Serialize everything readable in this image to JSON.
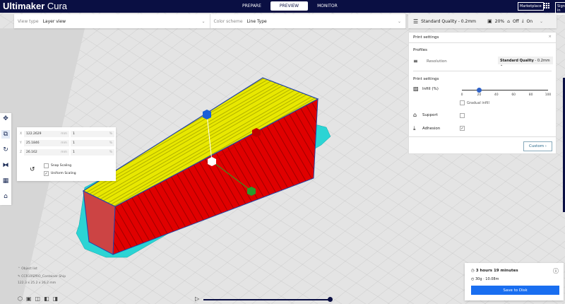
{
  "app": {
    "title_bold": "Ultimaker",
    "title_light": " Cura"
  },
  "nav": {
    "tabs": [
      {
        "label": "PREPARE",
        "active": false
      },
      {
        "label": "PREVIEW",
        "active": true
      },
      {
        "label": "MONITOR",
        "active": false
      }
    ],
    "marketplace": "Marketplace",
    "sign_in": "Sign in"
  },
  "viewbar": {
    "view_type_label": "View type",
    "view_type_value": "Layer view",
    "color_scheme_label": "Color scheme",
    "color_scheme_value": "Line Type"
  },
  "quality_bar": {
    "profile": "Standard Quality - 0.2mm",
    "infill": "20%",
    "support": "Off",
    "adhesion": "On"
  },
  "print_settings": {
    "title": "Print settings",
    "profiles_heading": "Profiles",
    "resolution_label": "Resolution",
    "resolution_value_bold": "Standard Quality",
    "resolution_value": " - 0.2mm",
    "settings_heading": "Print settings",
    "infill_label": "Infill (%)",
    "infill_value": 20,
    "infill_ticks": [
      "0",
      "20",
      "40",
      "60",
      "80",
      "100"
    ],
    "gradual_infill_label": "Gradual infill",
    "gradual_infill": false,
    "support_label": "Support",
    "support": false,
    "adhesion_label": "Adhesion",
    "adhesion": true,
    "custom_label": "Custom"
  },
  "scale_tool": {
    "rows": [
      {
        "axis": "X",
        "mm": "122.2629",
        "unit": "mm",
        "pct": "1",
        "pct_unit": "%"
      },
      {
        "axis": "Y",
        "mm": "25.1846",
        "unit": "mm",
        "pct": "1",
        "pct_unit": "%"
      },
      {
        "axis": "Z",
        "mm": "26.162",
        "unit": "mm",
        "pct": "1",
        "pct_unit": "%"
      }
    ],
    "snap_scaling": "Snap Scaling",
    "snap": false,
    "uniform_scaling": "Uniform Scaling",
    "uniform": true
  },
  "object_info": {
    "heading": "Object list",
    "name": "CCR10SPRO_Container Ship",
    "dimensions": "122.3 x 25.2 x 26.2 mm"
  },
  "estimate": {
    "time": "3 hours 19 minutes",
    "material": "30g · 10.08m",
    "save_label": "Save to Disk"
  },
  "colors": {
    "header": "#0a0f43",
    "accent": "#196ef0",
    "infill": "#e8e800",
    "wall": "#e00000",
    "skirt": "#2bd4d4"
  }
}
